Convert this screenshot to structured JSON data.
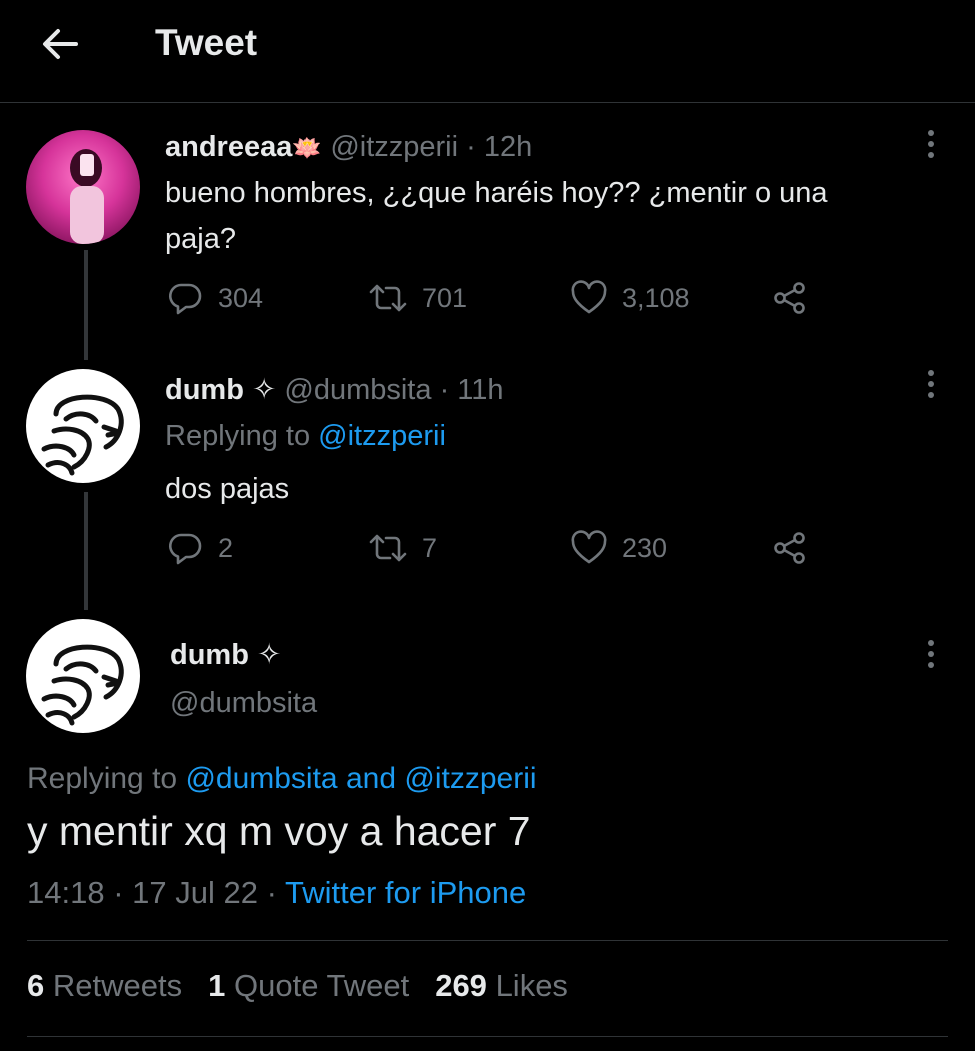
{
  "header": {
    "title": "Tweet",
    "back_icon": "arrow-left-icon"
  },
  "tweets": [
    {
      "display_name": "andreeaa",
      "name_emoji": "🪷",
      "handle": "@itzzperii",
      "separator": "·",
      "time": "12h",
      "text_lines": [
        "bueno hombres, ¿¿que haréis hoy?? ¿mentir o una",
        "paja?"
      ],
      "replies": "304",
      "retweets": "701",
      "likes": "3,108"
    },
    {
      "display_name": "dumb",
      "name_glyph": "✧",
      "handle": "@dumbsita",
      "separator": "·",
      "time": "11h",
      "replying_prefix": "Replying to",
      "replying_to": "@itzzperii",
      "text": "dos pajas",
      "replies": "2",
      "retweets": "7",
      "likes": "230"
    }
  ],
  "main_tweet": {
    "display_name": "dumb",
    "name_glyph": "✧",
    "handle": "@dumbsita",
    "replying_prefix": "Replying to",
    "replying_to_1": "@dumbsita",
    "replying_and": "and",
    "replying_to_2": "@itzzperii",
    "text": "y mentir xq m voy a hacer 7",
    "time": "14:18",
    "separator": "·",
    "date": "17 Jul 22",
    "source": "Twitter for iPhone",
    "stats": {
      "retweets_count": "6",
      "retweets_label": "Retweets",
      "quotes_count": "1",
      "quotes_label": "Quote Tweet",
      "likes_count": "269",
      "likes_label": "Likes"
    }
  },
  "colors": {
    "background": "#000000",
    "text": "#e7e9ea",
    "muted": "#71767b",
    "link": "#1d9bf0",
    "divider": "#2f3336"
  }
}
